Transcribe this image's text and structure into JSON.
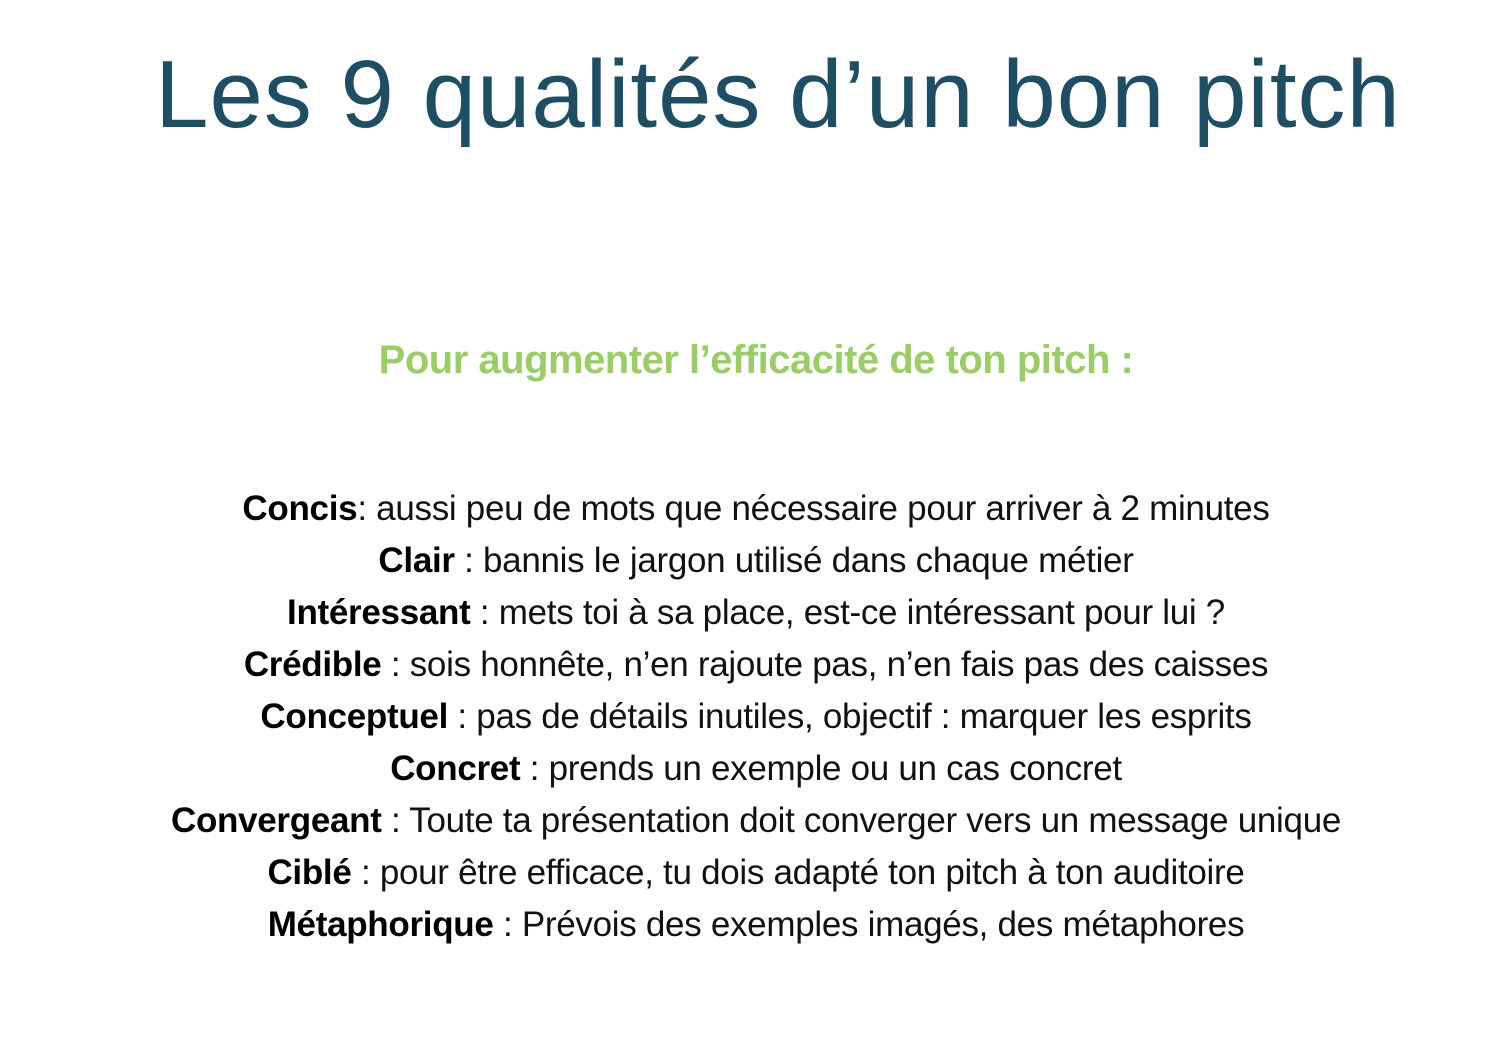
{
  "title": "Les 9 qualités d’un bon pitch",
  "subtitle": "Pour augmenter l’efficacité de ton pitch :",
  "colors": {
    "title": "#1f4e63",
    "subtitle": "#9ccc6a",
    "text": "#111111",
    "background": "#ffffff"
  },
  "qualities": [
    {
      "term": "Concis",
      "sep": ": ",
      "desc": "aussi peu de mots que nécessaire pour arriver à 2 minutes"
    },
    {
      "term": "Clair",
      "sep": " : ",
      "desc": "bannis le jargon utilisé dans chaque métier"
    },
    {
      "term": "Intéressant",
      "sep": " : ",
      "desc": "mets toi à sa place, est-ce intéressant pour lui ?"
    },
    {
      "term": "Crédible",
      "sep": " : ",
      "desc": "sois honnête, n’en rajoute pas, n’en fais pas des caisses"
    },
    {
      "term": "Conceptuel",
      "sep": " : ",
      "desc": "pas de détails inutiles, objectif : marquer les esprits"
    },
    {
      "term": "Concret",
      "sep": " : ",
      "desc": "prends un exemple ou un cas concret"
    },
    {
      "term": "Convergeant",
      "sep": " : ",
      "desc": "Toute ta présentation doit converger vers un message unique"
    },
    {
      "term": "Ciblé",
      "sep": " : ",
      "desc": "pour être efficace, tu dois adapté ton pitch à ton auditoire"
    },
    {
      "term": "Métaphorique",
      "sep": " : ",
      "desc": "Prévois des exemples imagés, des métaphores"
    }
  ]
}
